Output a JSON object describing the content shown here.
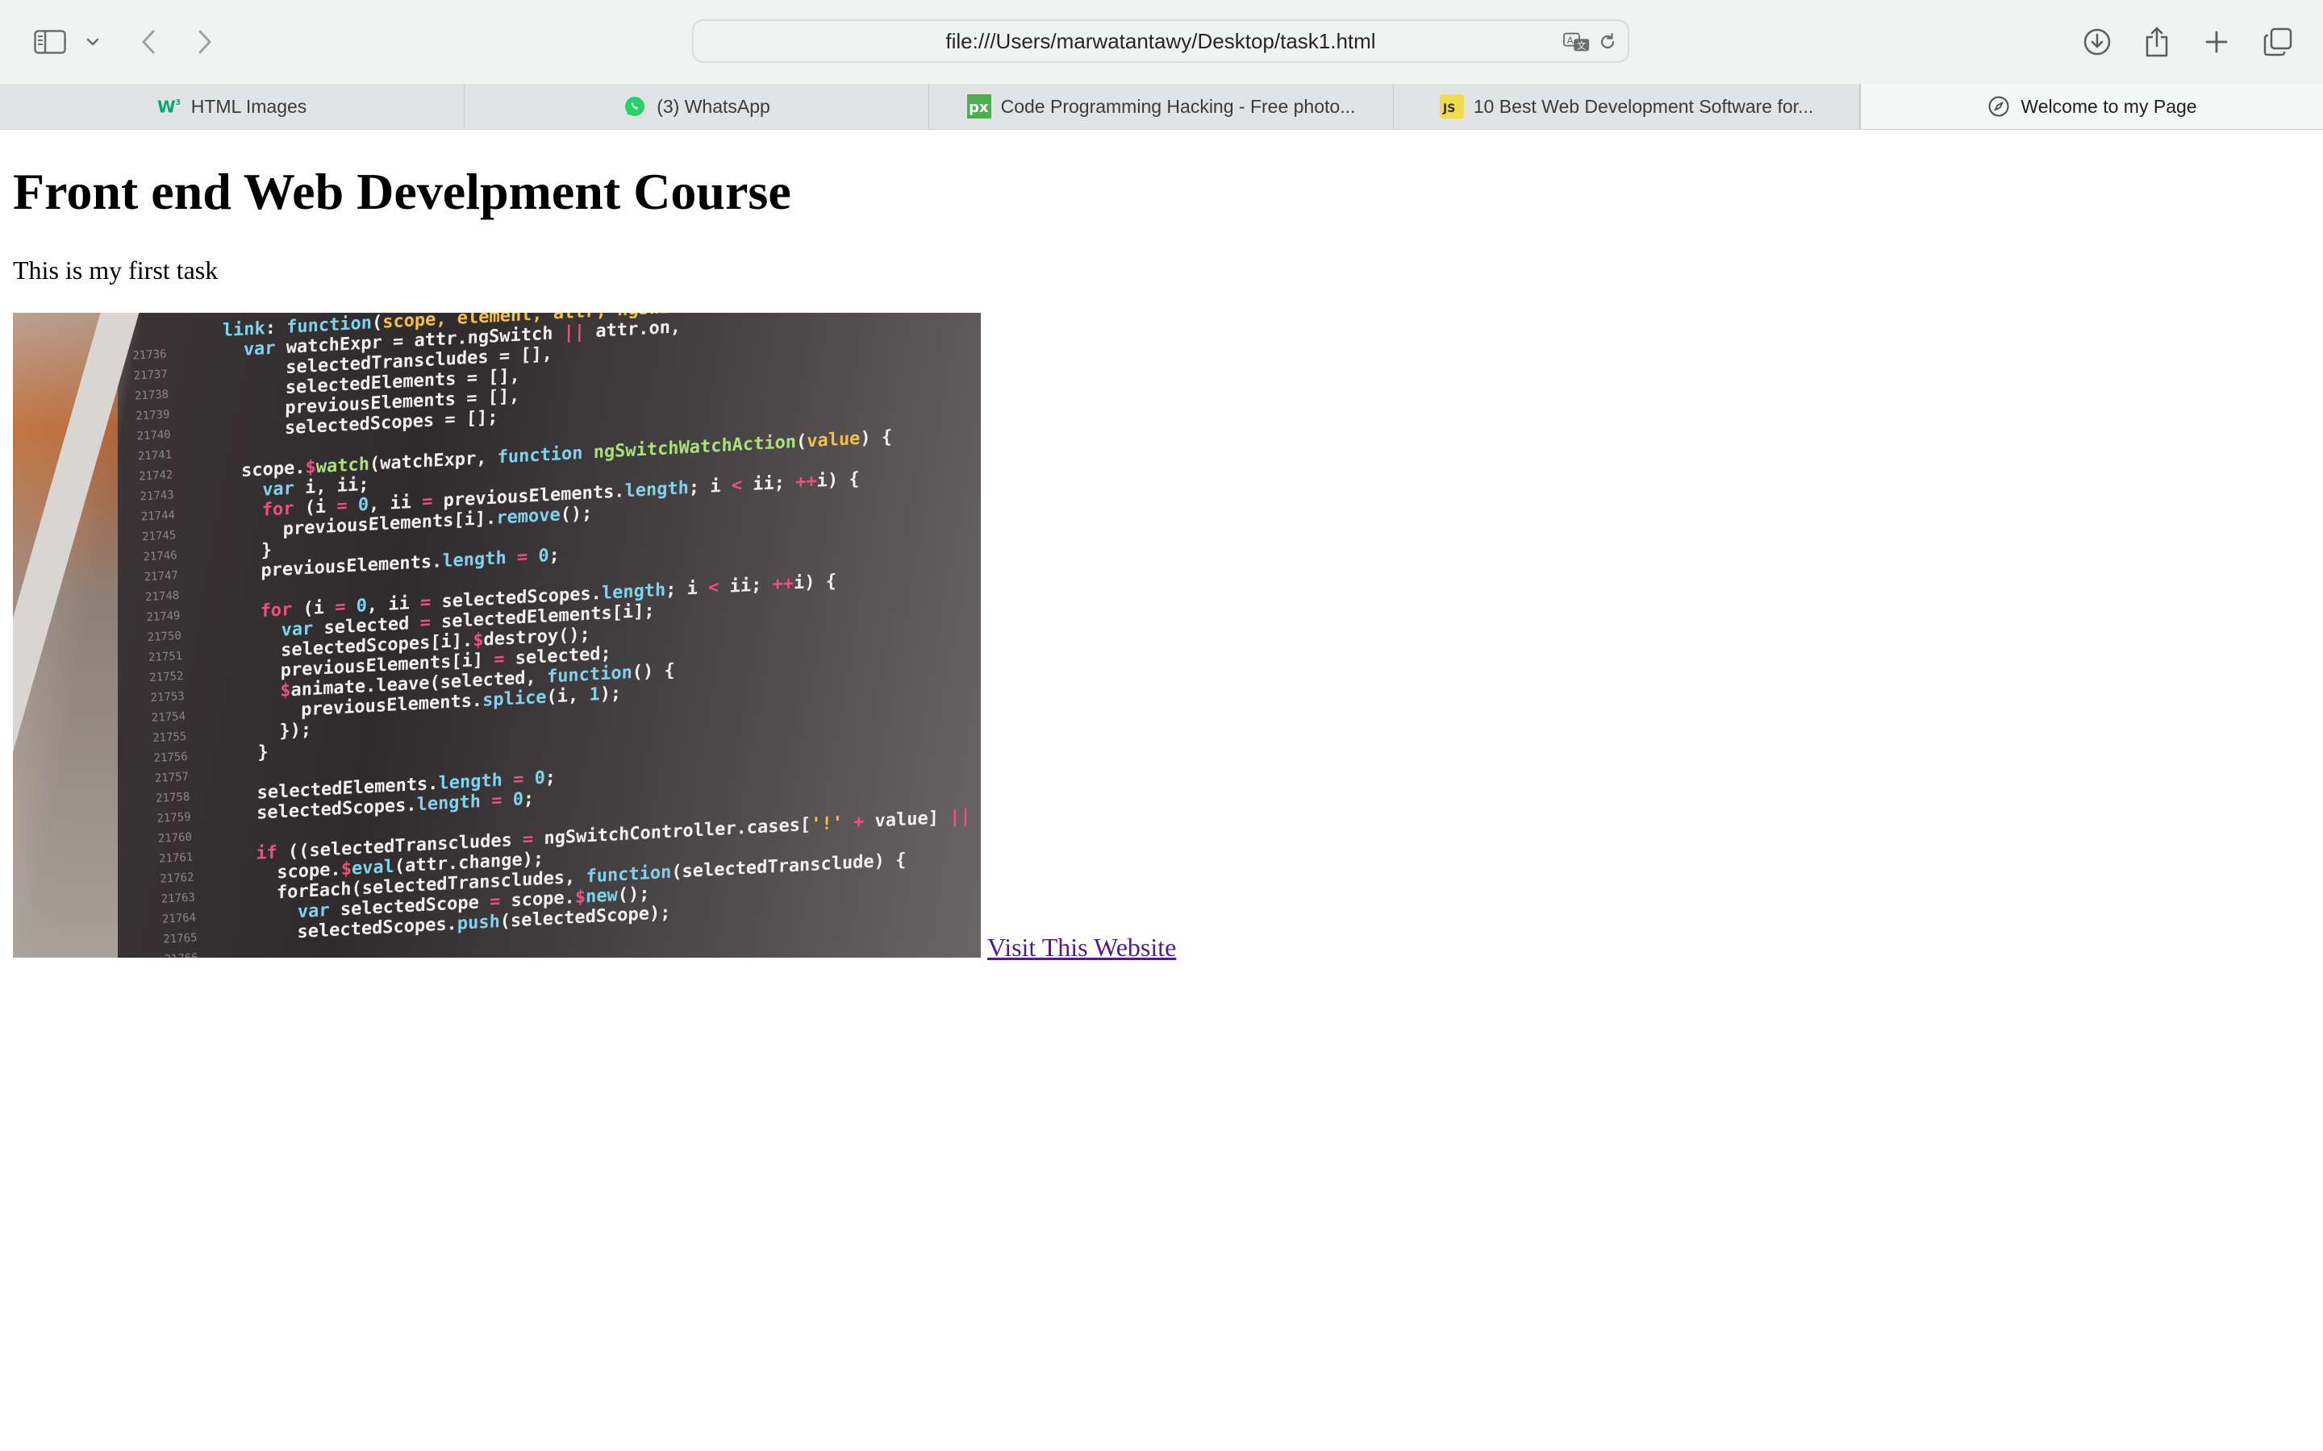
{
  "browser": {
    "address_url": "file:///Users/marwatantawy/Desktop/task1.html",
    "toolbar_icons": [
      "sidebar-icon",
      "chevron-down-icon",
      "back-icon",
      "forward-icon",
      "translate-icon",
      "reload-icon",
      "download-icon",
      "share-icon",
      "new-tab-icon",
      "tab-overview-icon"
    ],
    "tabs": [
      {
        "label": "HTML Images",
        "favicon": "w3schools-icon",
        "active": false
      },
      {
        "label": "(3) WhatsApp",
        "favicon": "whatsapp-icon",
        "active": false
      },
      {
        "label": "Code Programming Hacking - Free photo...",
        "favicon": "pixabay-icon",
        "active": false
      },
      {
        "label": "10 Best Web Development Software for...",
        "favicon": "js-icon",
        "active": false
      },
      {
        "label": "Welcome to my Page",
        "favicon": "compass-icon",
        "active": true
      }
    ]
  },
  "page": {
    "heading": "Front end Web Develpment Course",
    "paragraph": "This is my first task",
    "image_subject": "laptop screen showing source code",
    "link_text": "Visit This Website"
  },
  "colors": {
    "toolbar_bg": "#f1f2f2",
    "tabbar_bg": "#e1e3e4",
    "visited_link": "#551a8b",
    "whatsapp_green": "#25d366",
    "w3_green": "#04aa6d",
    "pixabay_green": "#4bae4f",
    "js_yellow": "#f0db4f"
  }
}
